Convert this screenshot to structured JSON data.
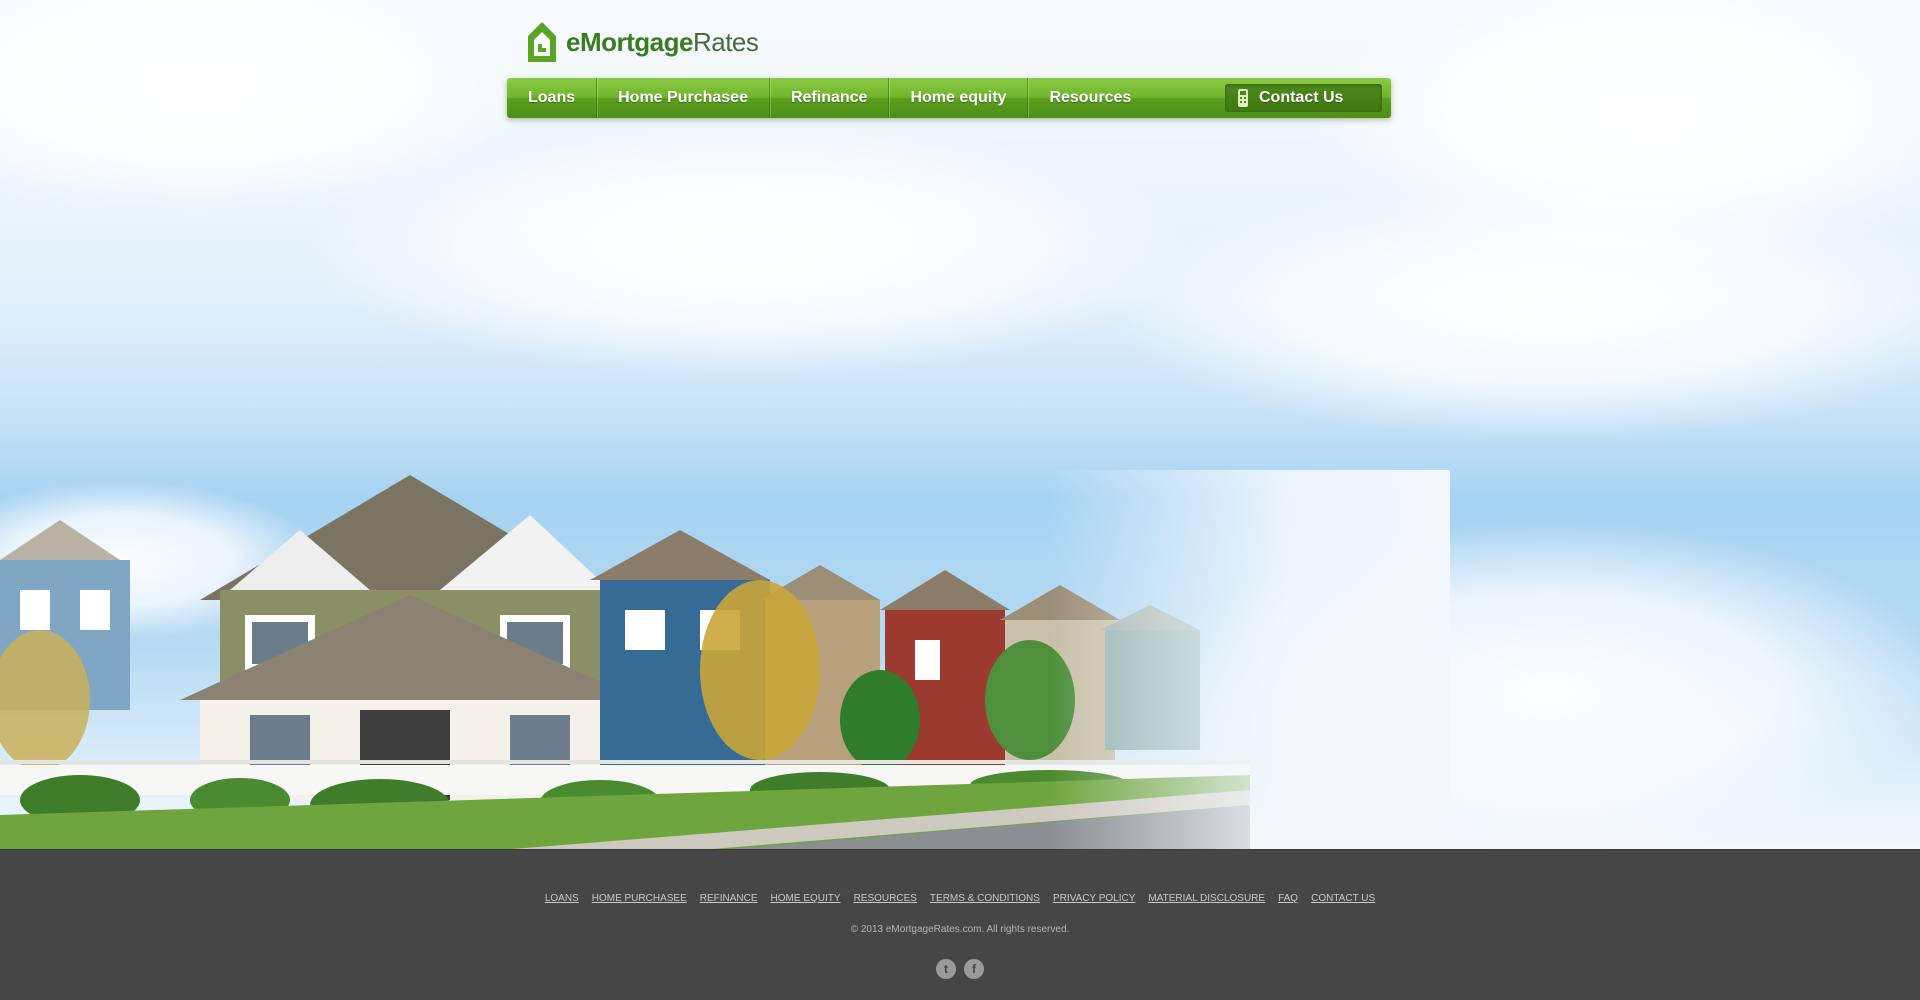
{
  "brand": {
    "name_bold": "eMortgage",
    "name_light": "Rates",
    "primary_color": "#6fb52c",
    "dark_color": "#3b7d1e"
  },
  "nav": {
    "items": [
      {
        "label": "Loans"
      },
      {
        "label": "Home Purchasee"
      },
      {
        "label": "Refinance"
      },
      {
        "label": "Home equity"
      },
      {
        "label": "Resources"
      }
    ],
    "contact": {
      "label": "Contact Us",
      "icon": "phone-icon"
    }
  },
  "footer": {
    "links": [
      {
        "label": "LOANS"
      },
      {
        "label": "HOME PURCHASEE"
      },
      {
        "label": "REFINANCE"
      },
      {
        "label": "HOME EQUITY"
      },
      {
        "label": "RESOURCES"
      },
      {
        "label": "TERMS & CONDITIONS"
      },
      {
        "label": "PRIVACY POLICY"
      },
      {
        "label": "MATERIAL DISCLOSURE"
      },
      {
        "label": "FAQ"
      },
      {
        "label": "CONTACT US"
      }
    ],
    "copyright": "© 2013 eMortgageRates.com. All rights reserved.",
    "social": [
      {
        "icon": "twitter-icon",
        "glyph": "t"
      },
      {
        "icon": "facebook-icon",
        "glyph": "f"
      }
    ],
    "background": "#464646"
  }
}
